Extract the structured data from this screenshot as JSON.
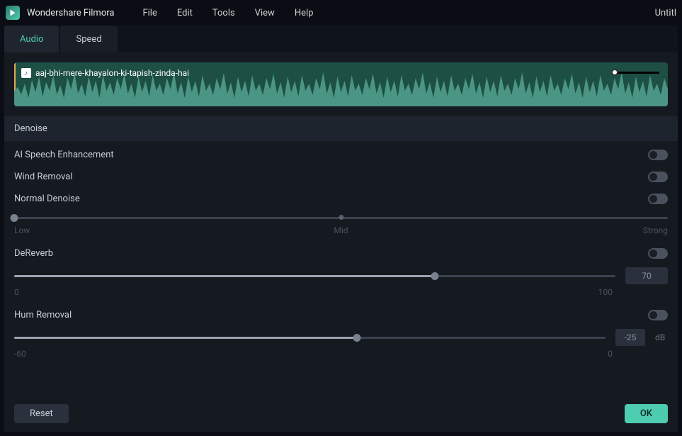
{
  "app": {
    "name": "Wondershare Filmora",
    "doc_title": "Untitl"
  },
  "menu": {
    "items": [
      "File",
      "Edit",
      "Tools",
      "View",
      "Help"
    ]
  },
  "tabs": [
    {
      "label": "Audio",
      "active": true
    },
    {
      "label": "Speed",
      "active": false
    }
  ],
  "clip": {
    "name": "aaj-bhi-mere-khayalon-ki-tapish-zinda-hai"
  },
  "section": {
    "title": "Denoise"
  },
  "controls": {
    "ai_speech": {
      "label": "AI Speech Enhancement",
      "enabled": false
    },
    "wind_removal": {
      "label": "Wind Removal",
      "enabled": false
    },
    "normal_denoise": {
      "label": "Normal Denoise",
      "enabled": false,
      "slider": {
        "position": 0,
        "labels": [
          "Low",
          "Mid",
          "Strong"
        ]
      }
    },
    "dereverb": {
      "label": "DeReverb",
      "enabled": false,
      "slider": {
        "position": 70,
        "min": 0,
        "max": 100,
        "value": "70"
      }
    },
    "hum_removal": {
      "label": "Hum Removal",
      "enabled": false,
      "slider": {
        "position": 58,
        "min": "-60",
        "max": "0",
        "value": "-25",
        "unit": "dB"
      }
    }
  },
  "footer": {
    "reset": "Reset",
    "ok": "OK"
  }
}
